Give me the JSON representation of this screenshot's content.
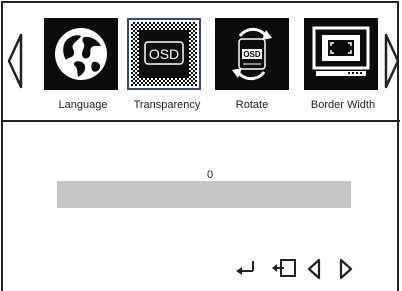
{
  "menu": {
    "items": [
      {
        "label": "Language",
        "icon": "globe-icon"
      },
      {
        "label": "Transparency",
        "icon": "osd-transparency-icon",
        "selected": true,
        "icon_text": "OSD"
      },
      {
        "label": "Rotate",
        "icon": "osd-rotate-icon",
        "icon_text": "OSD"
      },
      {
        "label": "Border Width",
        "icon": "monitor-border-icon"
      }
    ]
  },
  "transparency": {
    "value": "0",
    "level": 0
  },
  "footer": {
    "buttons": [
      "enter-icon",
      "exit-icon",
      "left-arrow-icon",
      "right-arrow-icon"
    ]
  },
  "colors": {
    "accent": "#2e4a8e",
    "slider_track": "#c6c6c6",
    "frame": "#222222"
  }
}
